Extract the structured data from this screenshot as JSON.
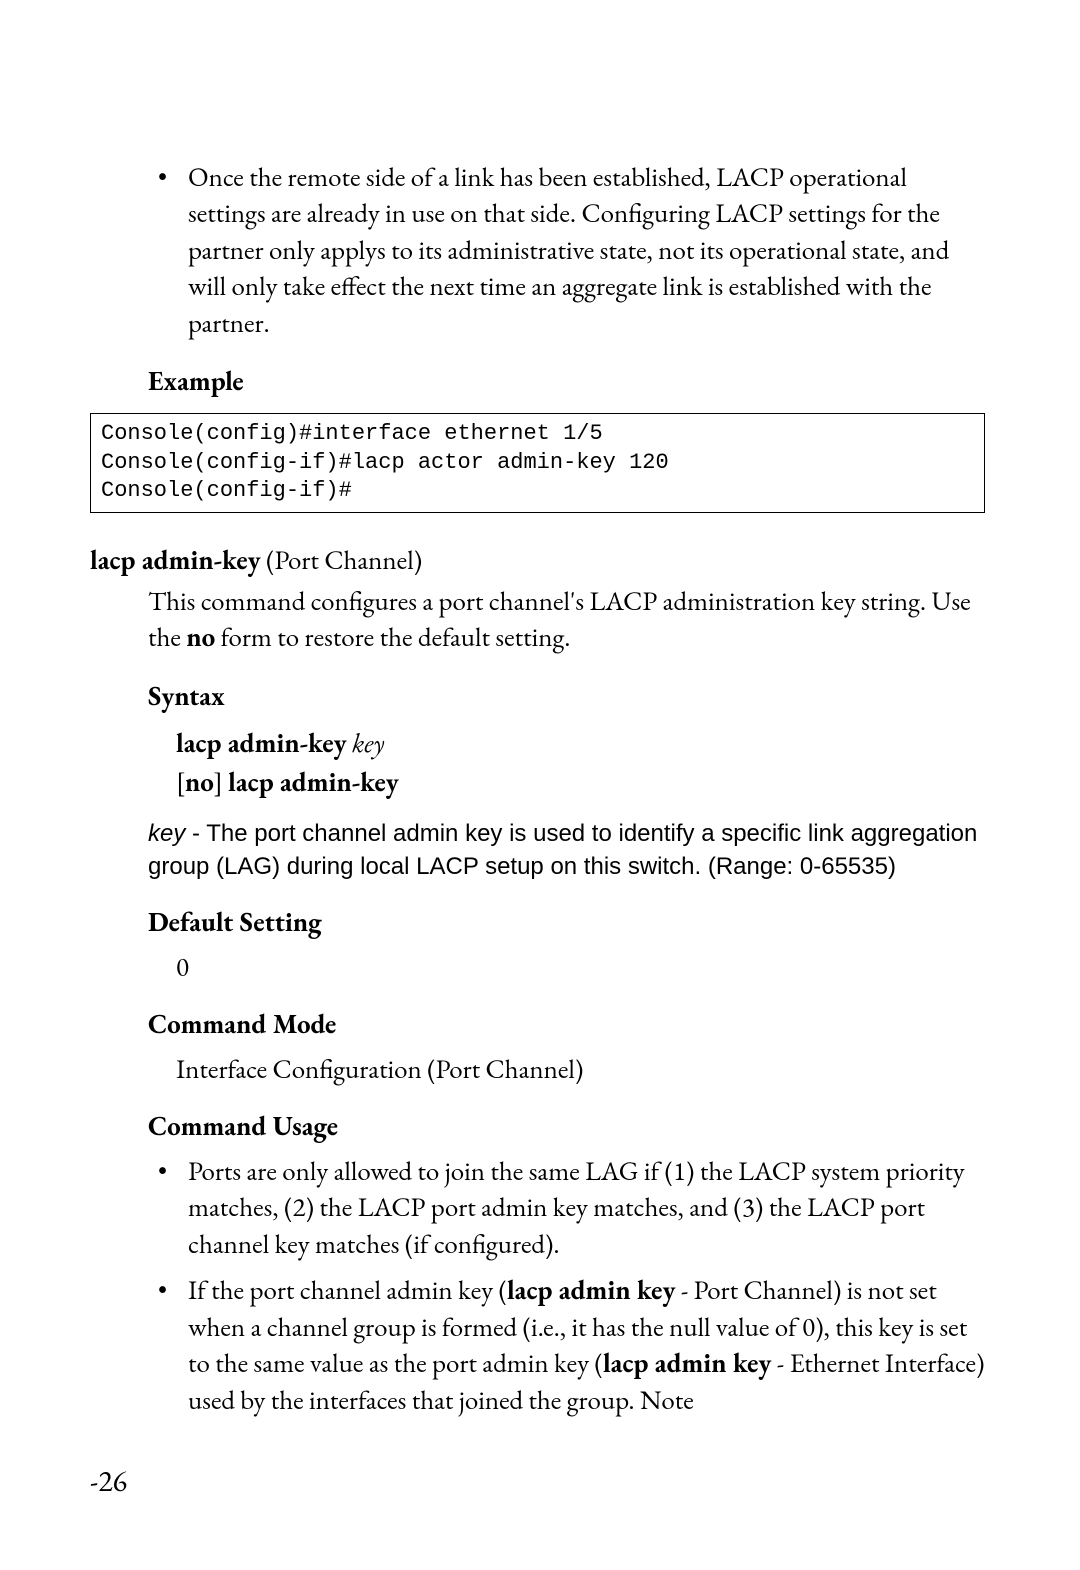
{
  "top_bullet": "Once the remote side of a link has been established, LACP operational settings are already in use on that side. Configuring LACP settings for the partner only applys to its administrative state, not its operational state, and will only take effect the next time an aggregate link is established with the partner.",
  "example_heading": "Example",
  "code": "Console(config)#interface ethernet 1/5\nConsole(config-if)#lacp actor admin-key 120\nConsole(config-if)#",
  "cmd": {
    "title_bold": "lacp admin-key",
    "title_rest": " (Port Channel)",
    "desc_pre": "This command configures a port channel's LACP administration key string. Use the ",
    "desc_bold": "no",
    "desc_post": " form to restore the default setting."
  },
  "syntax_heading": "Syntax",
  "syntax": {
    "line1_bold": "lacp admin-key",
    "line1_ital": " key",
    "line2_pre": "[",
    "line2_bold1": "no",
    "line2_mid": "] ",
    "line2_bold2": "lacp admin-key"
  },
  "key_desc": {
    "ital": "key",
    "text": " - The port channel admin key is used to identify a specific link aggregation group (LAG) during local LACP setup on this switch. (Range: 0-65535)"
  },
  "default_heading": "Default Setting",
  "default_value": "0",
  "mode_heading": "Command Mode",
  "mode_value": "Interface Configuration (Port Channel)",
  "usage_heading": "Command Usage",
  "usage": [
    {
      "parts": [
        {
          "t": "Ports are only allowed to join the same LAG if (1) the LACP system priority matches, (2) the LACP port admin key matches, and (3) the LACP port channel key matches (if configured).",
          "b": false
        }
      ]
    },
    {
      "parts": [
        {
          "t": "If the port channel admin key (",
          "b": false
        },
        {
          "t": "lacp admin key",
          "b": true
        },
        {
          "t": " - Port Channel) is not set when a channel group is formed (i.e., it has the null value of 0), this key is set to the same value as the port admin key (",
          "b": false
        },
        {
          "t": "lacp admin key",
          "b": true
        },
        {
          "t": " - Ethernet Interface) used by the interfaces that joined the group. Note",
          "b": false
        }
      ]
    }
  ],
  "page_number": "-26"
}
